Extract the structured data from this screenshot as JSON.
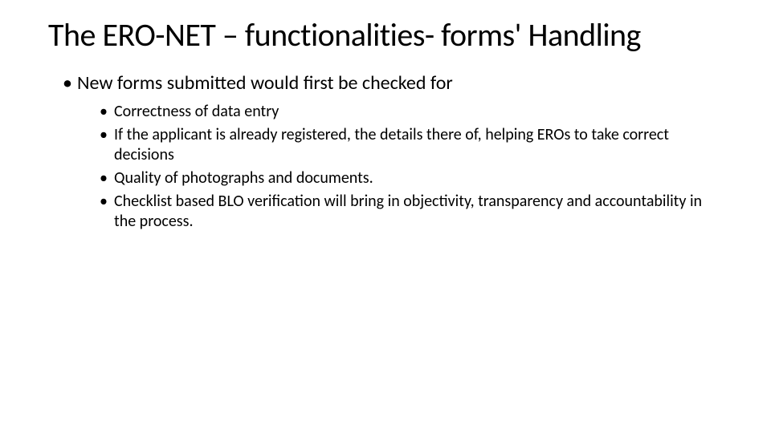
{
  "title": "The ERO-NET – functionalities- forms' Handling",
  "bullets": [
    {
      "text": "New forms submitted would first be checked for",
      "children": [
        "Correctness of data entry",
        "If the applicant is already registered, the details there of, helping EROs to take correct decisions",
        "Quality of photographs and documents.",
        "Checklist based BLO verification will bring in objectivity, transparency and accountability in the process."
      ]
    }
  ]
}
